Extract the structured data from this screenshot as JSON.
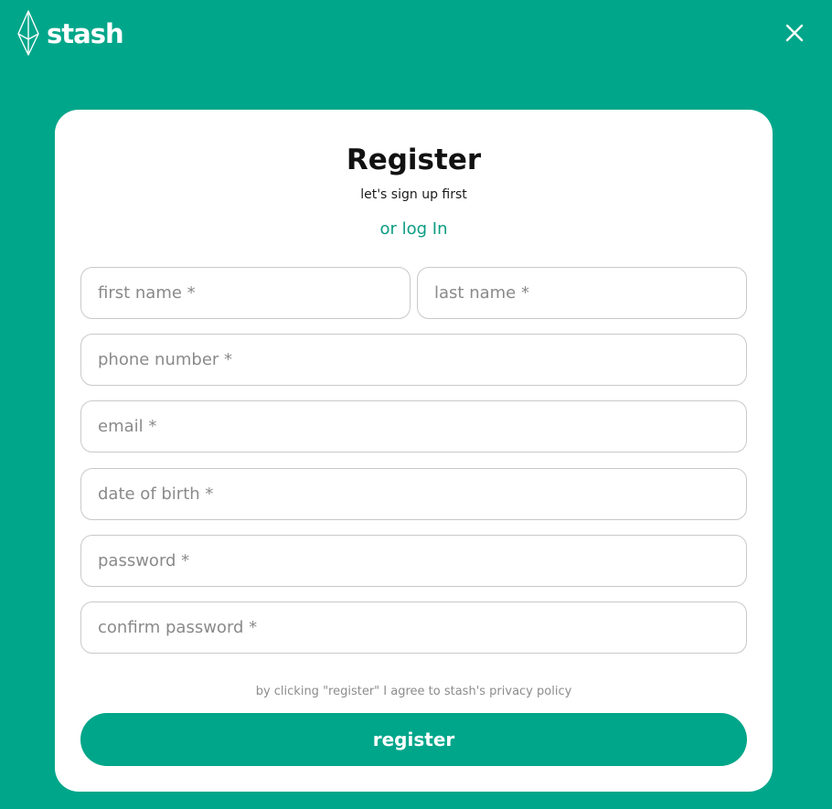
{
  "colors": {
    "brand": "#00a68a",
    "card": "#ffffff",
    "link": "#0a9c82",
    "field_border": "#c9c9c9",
    "placeholder": "#8a8a8a"
  },
  "header": {
    "logo_icon": "diamond-outline-icon",
    "logo_text": "stash",
    "close_icon": "close-icon"
  },
  "form": {
    "title": "Register",
    "subtitle": "let's sign up first",
    "login_link": "or log In",
    "fields": {
      "first_name": {
        "placeholder": "first name *",
        "value": ""
      },
      "last_name": {
        "placeholder": "last name *",
        "value": ""
      },
      "phone": {
        "placeholder": "phone number *",
        "value": ""
      },
      "email": {
        "placeholder": "email *",
        "value": ""
      },
      "dob": {
        "placeholder": "date of birth *",
        "value": ""
      },
      "password": {
        "placeholder": "password *",
        "value": ""
      },
      "confirm_password": {
        "placeholder": "confirm password *",
        "value": ""
      }
    },
    "legal": "by clicking \"register\" I agree to stash's privacy policy",
    "submit_label": "register"
  }
}
